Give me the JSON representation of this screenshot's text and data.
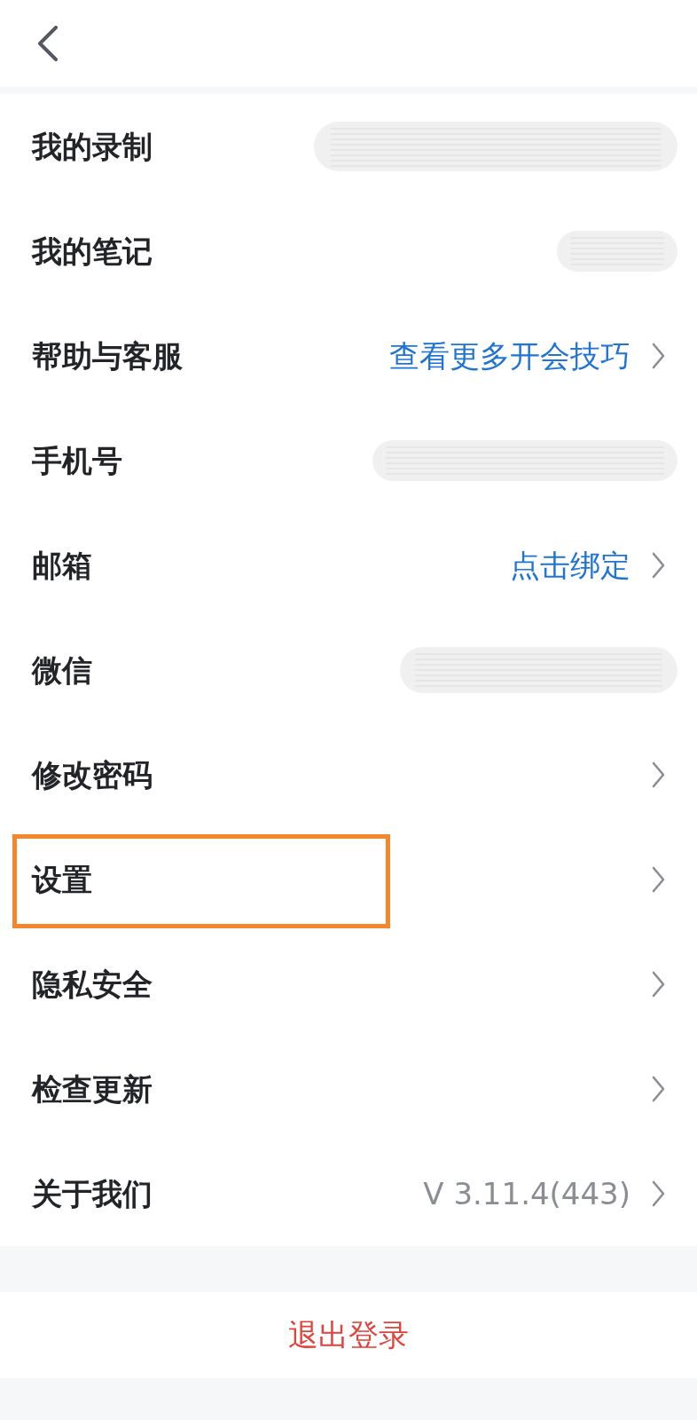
{
  "rows": [
    {
      "label": "我的录制",
      "kind": "redacted",
      "highlighted": false
    },
    {
      "label": "我的笔记",
      "kind": "redacted",
      "highlighted": false
    },
    {
      "label": "帮助与客服",
      "kind": "link",
      "value": "查看更多开会技巧",
      "highlighted": false
    },
    {
      "label": "手机号",
      "kind": "redacted",
      "highlighted": false
    },
    {
      "label": "邮箱",
      "kind": "link",
      "value": "点击绑定",
      "highlighted": false
    },
    {
      "label": "微信",
      "kind": "redacted",
      "highlighted": false
    },
    {
      "label": "修改密码",
      "kind": "nav",
      "highlighted": false
    },
    {
      "label": "设置",
      "kind": "nav",
      "highlighted": true
    },
    {
      "label": "隐私安全",
      "kind": "nav",
      "highlighted": false
    },
    {
      "label": "检查更新",
      "kind": "nav",
      "highlighted": false
    },
    {
      "label": "关于我们",
      "kind": "info",
      "value": "V 3.11.4(443)",
      "highlighted": false
    }
  ],
  "logout": {
    "label": "退出登录"
  }
}
